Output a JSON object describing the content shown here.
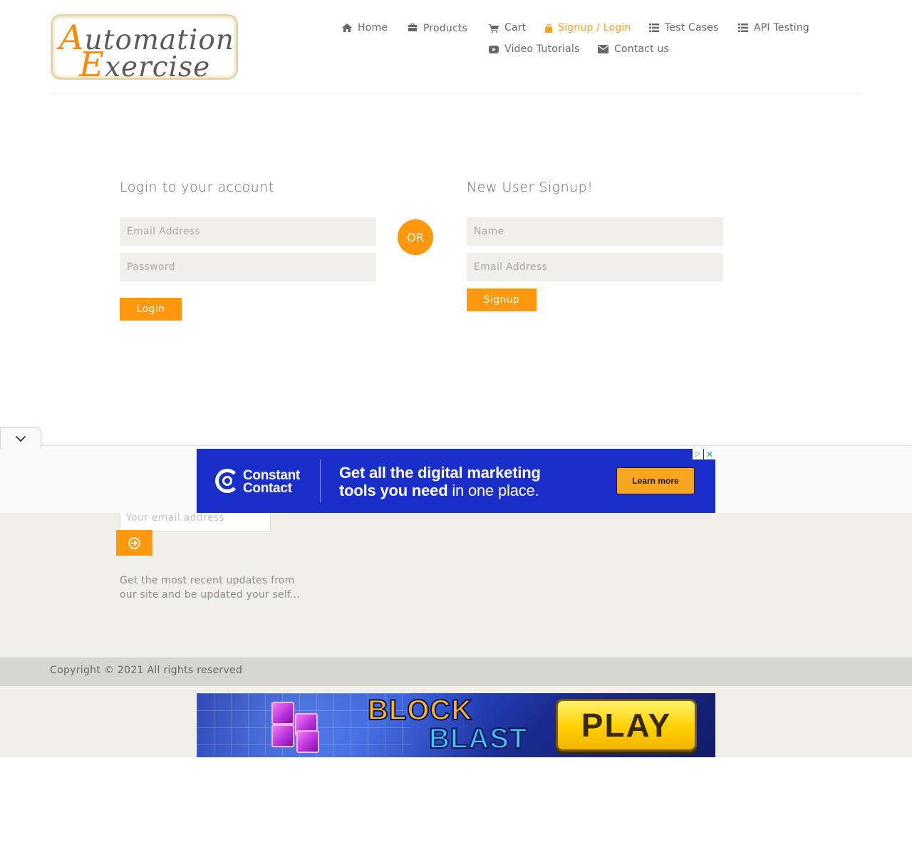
{
  "brand": {
    "logo_line1_initial": "A",
    "logo_line1_rest": "utomation",
    "logo_line2_initial": "E",
    "logo_line2_rest": "xercise",
    "accent_color": "#fe980f",
    "muted_text_color": "#696763",
    "footer_bg_color": "#f0f0e9"
  },
  "nav": {
    "items": [
      {
        "label": "Home",
        "icon": "home-icon",
        "active": false
      },
      {
        "label": "Products",
        "icon": "briefcase-icon",
        "active": false
      },
      {
        "label": "Cart",
        "icon": "shopping-cart-icon",
        "active": false
      },
      {
        "label": "Signup / Login",
        "icon": "lock-icon",
        "active": true
      },
      {
        "label": "Test Cases",
        "icon": "list-icon",
        "active": false
      },
      {
        "label": "API Testing",
        "icon": "list-icon",
        "active": false
      },
      {
        "label": "Video Tutorials",
        "icon": "youtube-play-icon",
        "active": false
      },
      {
        "label": "Contact us",
        "icon": "envelope-icon",
        "active": false
      }
    ]
  },
  "login": {
    "title": "Login to your account",
    "email_placeholder": "Email Address",
    "email_value": "",
    "password_placeholder": "Password",
    "password_value": "",
    "button_label": "Login"
  },
  "or_label": "OR",
  "signup": {
    "title": "New User Signup!",
    "name_placeholder": "Name",
    "name_value": "",
    "email_placeholder": "Email Address",
    "email_value": "",
    "button_label": "Signup"
  },
  "footer": {
    "subscribe_placeholder": "Your email address",
    "subscribe_value": "",
    "subscribe_button_icon": "arrow-circle-right-icon",
    "subscribe_text": "Get the most recent updates from our site and be updated your self...",
    "copyright": "Copyright © 2021 All rights reserved"
  },
  "ads": {
    "anchor_toggle_icon": "chevron-down-icon",
    "constant_contact": {
      "brand_line1": "Constant",
      "brand_line2": "Contact",
      "headline_line1": "Get all the digital marketing",
      "headline_line2_bold": "tools you need",
      "headline_line2_light": " in one place.",
      "cta": "Learn more",
      "choices_icon": "ad-choices-icon",
      "close_icon": "close-icon",
      "bg_color": "#1a2ec9",
      "cta_color": "#f7a51e"
    },
    "block_blast": {
      "word1": "BLOCK",
      "word2": "BLAST",
      "cta": "PLAY"
    }
  }
}
